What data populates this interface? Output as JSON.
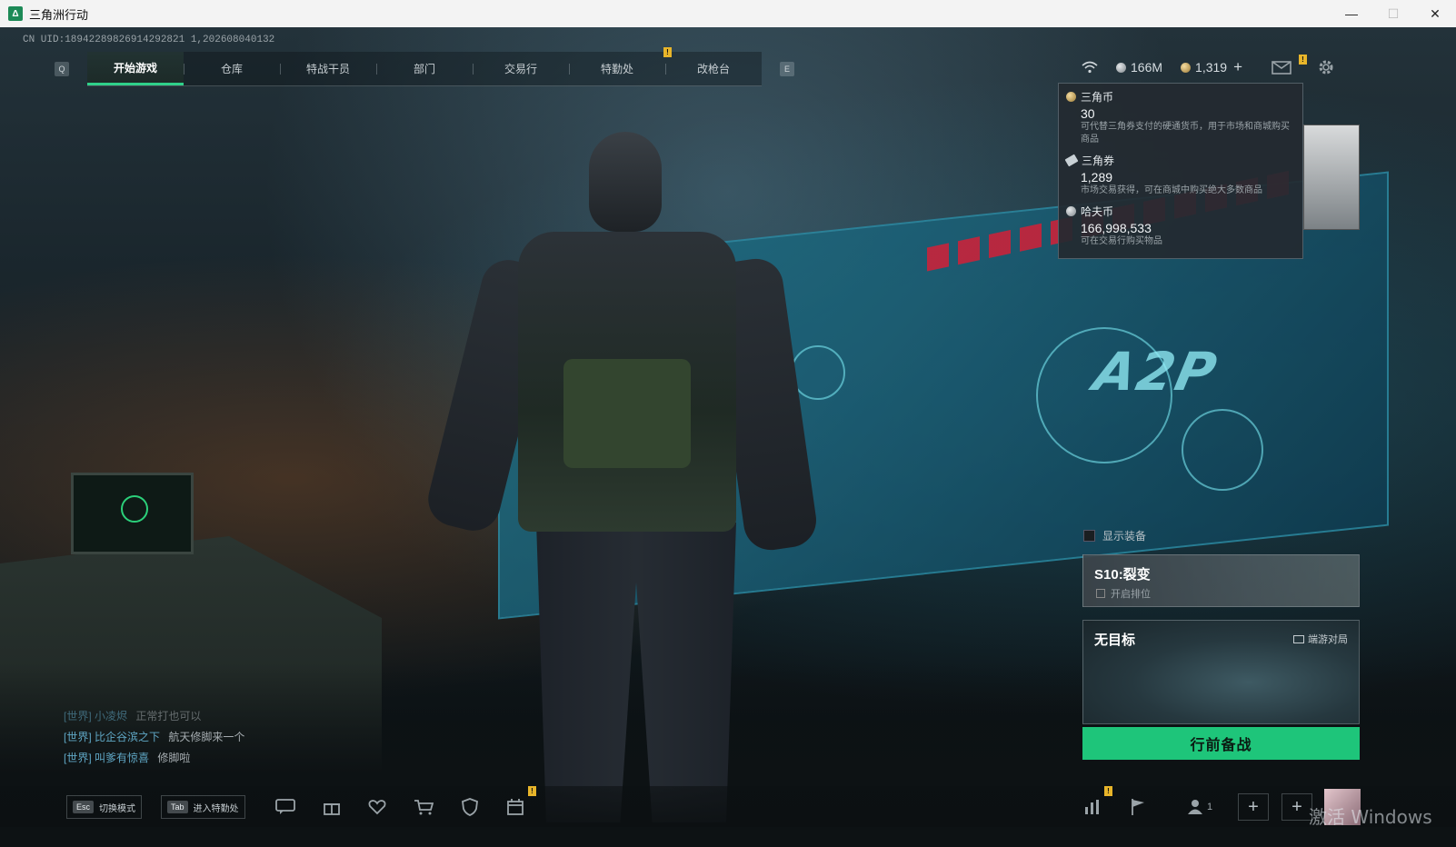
{
  "window": {
    "title": "三角洲行动",
    "app_icon": "Δ",
    "minimize": "—",
    "maximize": "☐",
    "close": "✕"
  },
  "uid_text": "CN UID:18942289826914292821 1,202608040132",
  "nav": {
    "left_key": "Q",
    "right_key": "E",
    "tabs": [
      {
        "label": "开始游戏",
        "active": true
      },
      {
        "label": "仓库",
        "active": false
      },
      {
        "label": "特战干员",
        "active": false
      },
      {
        "label": "部门",
        "active": false
      },
      {
        "label": "交易行",
        "active": false
      },
      {
        "label": "特勤处",
        "active": false
      },
      {
        "label": "改枪台",
        "active": false
      }
    ],
    "notice_mark": "!"
  },
  "status": {
    "wifi_icon": "wifi-icon",
    "haf_coin": "166M",
    "delta_coin": "1,319",
    "plus": "+",
    "mail_icon": "mail-icon",
    "settings_icon": "gear-icon",
    "notice_mark": "!"
  },
  "currency_popup": {
    "items": [
      {
        "name": "三角币",
        "amount": "30",
        "desc": "可代替三角券支付的硬通货币，用于市场和商城购买商品"
      },
      {
        "name": "三角券",
        "amount": "1,289",
        "desc": "市场交易获得，可在商城中购买绝大多数商品"
      },
      {
        "name": "哈夫币",
        "amount": "166,998,533",
        "desc": "可在交易行购买物品"
      }
    ]
  },
  "right_panel": {
    "show_equipment": "显示装备",
    "season_title": "S10:裂变",
    "season_sub": "开启排位",
    "map_title": "无目标",
    "map_mode": "端游对局",
    "start_button": "行前备战"
  },
  "chat": [
    {
      "channel": "[世界]",
      "name": "小凌烬",
      "msg": "正常打也可以",
      "faded": true
    },
    {
      "channel": "[世界]",
      "name": "比企谷滨之下",
      "msg": "航天修脚来一个",
      "faded": false
    },
    {
      "channel": "[世界]",
      "name": "叫爹有惊喜",
      "msg": "修脚啦",
      "faded": false
    }
  ],
  "bottom": {
    "esc_key": "Esc",
    "esc_label": "切换模式",
    "tab_key": "Tab",
    "tab_label": "进入特勤处",
    "icons": [
      "chat-icon",
      "gift-icon",
      "heart-icon",
      "shop-cart-icon",
      "shield-icon",
      "calendar-icon"
    ],
    "right_icons": [
      "stats-icon",
      "flag-icon"
    ],
    "team_count": "1",
    "plus": "+",
    "notice_mark": "!"
  },
  "watermark": "激活 Windows"
}
